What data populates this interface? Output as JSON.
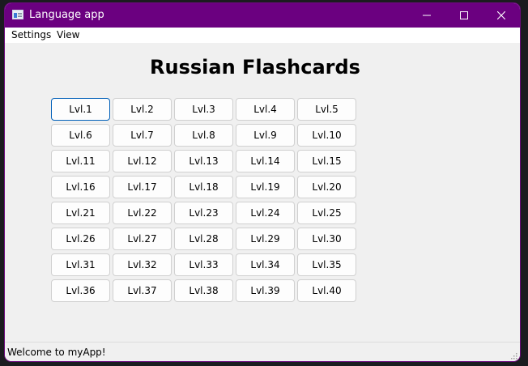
{
  "window": {
    "title": "Language app",
    "accent_color": "#6b0080",
    "icon": "app-window-icon"
  },
  "controls": {
    "minimize_icon": "minimize-icon",
    "maximize_icon": "maximize-icon",
    "close_icon": "close-icon"
  },
  "menu": {
    "items": [
      {
        "label": "Settings"
      },
      {
        "label": "View"
      }
    ]
  },
  "main": {
    "heading": "Russian Flashcards",
    "levels": [
      "Lvl.1",
      "Lvl.2",
      "Lvl.3",
      "Lvl.4",
      "Lvl.5",
      "Lvl.6",
      "Lvl.7",
      "Lvl.8",
      "Lvl.9",
      "Lvl.10",
      "Lvl.11",
      "Lvl.12",
      "Lvl.13",
      "Lvl.14",
      "Lvl.15",
      "Lvl.16",
      "Lvl.17",
      "Lvl.18",
      "Lvl.19",
      "Lvl.20",
      "Lvl.21",
      "Lvl.22",
      "Lvl.23",
      "Lvl.24",
      "Lvl.25",
      "Lvl.26",
      "Lvl.27",
      "Lvl.28",
      "Lvl.29",
      "Lvl.30",
      "Lvl.31",
      "Lvl.32",
      "Lvl.33",
      "Lvl.34",
      "Lvl.35",
      "Lvl.36",
      "Lvl.37",
      "Lvl.38",
      "Lvl.39",
      "Lvl.40"
    ],
    "focused_level": "Lvl.1"
  },
  "status": {
    "text": "Welcome to myApp!"
  }
}
